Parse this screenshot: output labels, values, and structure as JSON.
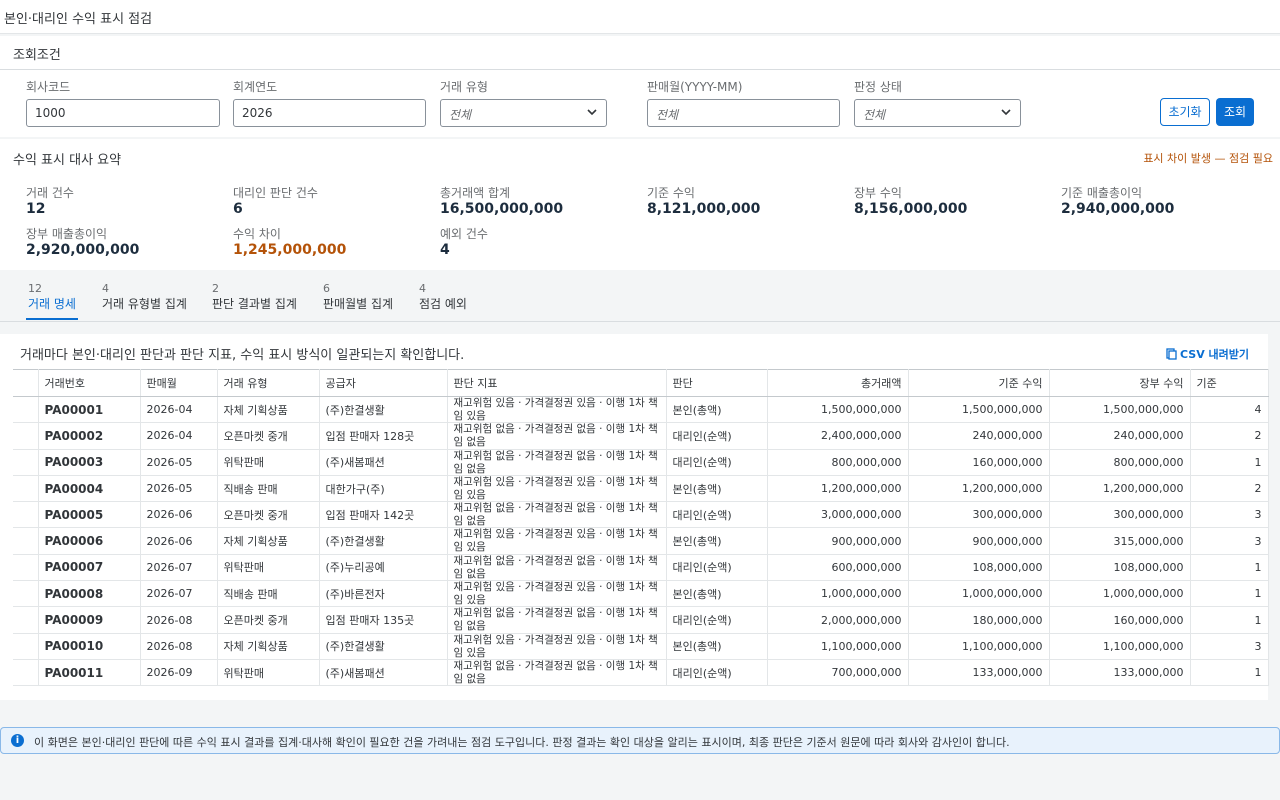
{
  "app": {
    "title": "본인·대리인 수익 표시 점검"
  },
  "conditions": {
    "title": "조회조건",
    "fields": [
      {
        "label": "회사코드",
        "value": "1000"
      },
      {
        "label": "회계연도",
        "value": "2026"
      },
      {
        "label": "거래 유형",
        "value": "전체"
      },
      {
        "label": "판매월(YYYY-MM)",
        "placeholder": "전체"
      },
      {
        "label": "판정 상태",
        "value": "전체"
      }
    ],
    "reset_label": "초기화",
    "search_label": "조회"
  },
  "summary": {
    "title": "수익 표시 대사 요약",
    "alert": "표시 차이 발생 — 점검 필요",
    "kpis": [
      {
        "label": "거래 건수",
        "value": "12"
      },
      {
        "label": "대리인 판단 건수",
        "value": "6"
      },
      {
        "label": "총거래액 합계",
        "value": "16,500,000,000"
      },
      {
        "label": "기준 수익",
        "value": "8,121,000,000"
      },
      {
        "label": "장부 수익",
        "value": "8,156,000,000"
      },
      {
        "label": "기준 매출총이익",
        "value": "2,940,000,000"
      },
      {
        "label": "장부 매출총이익",
        "value": "2,920,000,000"
      },
      {
        "label": "수익 차이",
        "value": "1,245,000,000"
      },
      {
        "label": "예외 건수",
        "value": "4"
      }
    ]
  },
  "tabs": [
    {
      "count": "12",
      "label": "거래 명세"
    },
    {
      "count": "4",
      "label": "거래 유형별 집계"
    },
    {
      "count": "2",
      "label": "판단 결과별 집계"
    },
    {
      "count": "6",
      "label": "판매월별 집계"
    },
    {
      "count": "4",
      "label": "점검 예외"
    }
  ],
  "table": {
    "description": "거래마다 본인·대리인 판단과 판단 지표, 수익 표시 방식이 일관되는지 확인합니다.",
    "csv_label": "CSV 내려받기",
    "columns": [
      "거래번호",
      "판매월",
      "거래 유형",
      "공급자",
      "판단 지표",
      "판단",
      "총거래액",
      "기준 수익",
      "장부 수익",
      "기준"
    ],
    "rows": [
      [
        "PA00001",
        "2026-04",
        "자체 기획상품",
        "(주)한결생활",
        "재고위험 있음 · 가격결정권 있음 · 이행 1차 책임 있음",
        "본인(총액)",
        "1,500,000,000",
        "1,500,000,000",
        "1,500,000,000",
        "4"
      ],
      [
        "PA00002",
        "2026-04",
        "오픈마켓 중개",
        "입점 판매자 128곳",
        "재고위험 없음 · 가격결정권 없음 · 이행 1차 책임 없음",
        "대리인(순액)",
        "2,400,000,000",
        "240,000,000",
        "240,000,000",
        "2"
      ],
      [
        "PA00003",
        "2026-05",
        "위탁판매",
        "(주)새봄패션",
        "재고위험 없음 · 가격결정권 없음 · 이행 1차 책임 없음",
        "대리인(순액)",
        "800,000,000",
        "160,000,000",
        "800,000,000",
        "1"
      ],
      [
        "PA00004",
        "2026-05",
        "직배송 판매",
        "대한가구(주)",
        "재고위험 있음 · 가격결정권 있음 · 이행 1차 책임 있음",
        "본인(총액)",
        "1,200,000,000",
        "1,200,000,000",
        "1,200,000,000",
        "2"
      ],
      [
        "PA00005",
        "2026-06",
        "오픈마켓 중개",
        "입점 판매자 142곳",
        "재고위험 없음 · 가격결정권 없음 · 이행 1차 책임 없음",
        "대리인(순액)",
        "3,000,000,000",
        "300,000,000",
        "300,000,000",
        "3"
      ],
      [
        "PA00006",
        "2026-06",
        "자체 기획상품",
        "(주)한결생활",
        "재고위험 있음 · 가격결정권 있음 · 이행 1차 책임 있음",
        "본인(총액)",
        "900,000,000",
        "900,000,000",
        "315,000,000",
        "3"
      ],
      [
        "PA00007",
        "2026-07",
        "위탁판매",
        "(주)누리공예",
        "재고위험 없음 · 가격결정권 없음 · 이행 1차 책임 없음",
        "대리인(순액)",
        "600,000,000",
        "108,000,000",
        "108,000,000",
        "1"
      ],
      [
        "PA00008",
        "2026-07",
        "직배송 판매",
        "(주)바른전자",
        "재고위험 있음 · 가격결정권 있음 · 이행 1차 책임 있음",
        "본인(총액)",
        "1,000,000,000",
        "1,000,000,000",
        "1,000,000,000",
        "1"
      ],
      [
        "PA00009",
        "2026-08",
        "오픈마켓 중개",
        "입점 판매자 135곳",
        "재고위험 없음 · 가격결정권 없음 · 이행 1차 책임 없음",
        "대리인(순액)",
        "2,000,000,000",
        "180,000,000",
        "160,000,000",
        "1"
      ],
      [
        "PA00010",
        "2026-08",
        "자체 기획상품",
        "(주)한결생활",
        "재고위험 있음 · 가격결정권 있음 · 이행 1차 책임 있음",
        "본인(총액)",
        "1,100,000,000",
        "1,100,000,000",
        "1,100,000,000",
        "3"
      ],
      [
        "PA00011",
        "2026-09",
        "위탁판매",
        "(주)새봄패션",
        "재고위험 없음 · 가격결정권 없음 · 이행 1차 책임 없음",
        "대리인(순액)",
        "700,000,000",
        "133,000,000",
        "133,000,000",
        "1"
      ]
    ]
  },
  "info": {
    "icon": "info-icon",
    "text": "이 화면은 본인·대리인 판단에 따른 수익 표시 결과를 집계·대사해 확인이 필요한 건을 가려내는 점검 도구입니다. 판정 결과는 확인 대상을 알리는 표시이며, 최종 판단은 기준서 원문에 따라 회사와 감사인이 합니다."
  },
  "colors": {
    "accent": "#0a6ed1",
    "warning": "#b45309"
  }
}
